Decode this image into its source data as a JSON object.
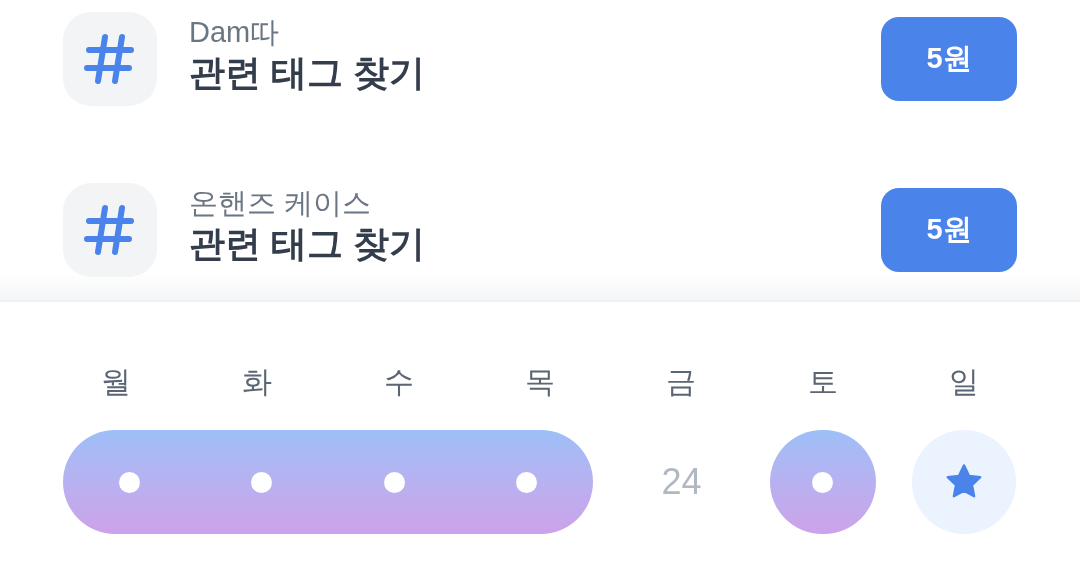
{
  "missions": [
    {
      "brand": "Dam따",
      "title": "관련 태그 찾기",
      "reward": "5원"
    },
    {
      "brand": "온핸즈 케이스",
      "title": "관련 태그 찾기",
      "reward": "5원"
    }
  ],
  "days": [
    {
      "label": "월",
      "kind": "day",
      "checked": true
    },
    {
      "label": "화",
      "kind": "day",
      "checked": true
    },
    {
      "label": "수",
      "kind": "day",
      "checked": true
    },
    {
      "label": "목",
      "kind": "day",
      "checked": true
    },
    {
      "label": "금",
      "kind": "day",
      "checked": false,
      "date": "24"
    },
    {
      "label": "토",
      "kind": "day",
      "checked": true
    },
    {
      "label": "일",
      "kind": "reward"
    }
  ]
}
